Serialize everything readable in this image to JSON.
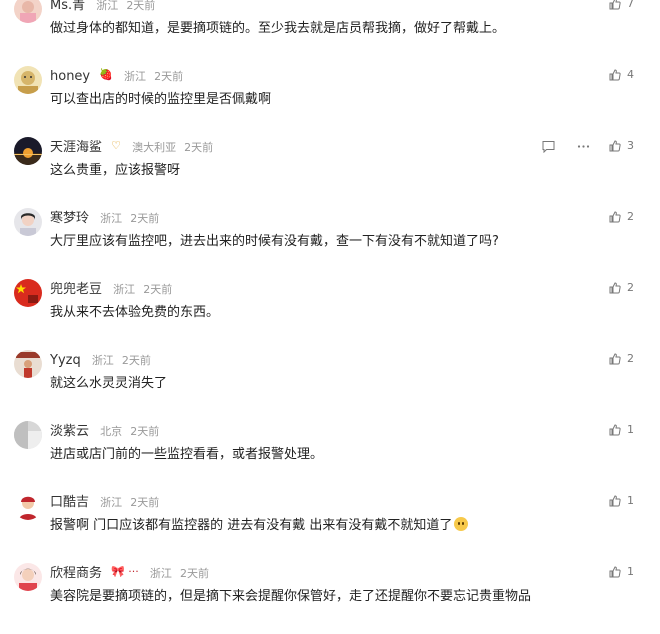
{
  "comments": [
    {
      "user": "Ms.青",
      "badge": "",
      "location": "浙江",
      "time": "2天前",
      "text": "做过身体的都知道，是要摘项链的。至少我去就是店员帮我摘，做好了帮戴上。",
      "likes": "7",
      "emoji": false
    },
    {
      "user": "honey",
      "badge": "🍓",
      "location": "浙江",
      "time": "2天前",
      "text": "可以查出店的时候的监控里是否佩戴啊",
      "likes": "4",
      "emoji": false
    },
    {
      "user": "天涯海鲨",
      "badge": "♡",
      "location": "澳大利亚",
      "time": "2天前",
      "text": "这么贵重，应该报警呀",
      "likes": "3",
      "emoji": false
    },
    {
      "user": "寒梦玲",
      "badge": "",
      "location": "浙江",
      "time": "2天前",
      "text": "大厅里应该有监控吧，进去出来的时候有没有戴，查一下有没有不就知道了吗?",
      "likes": "2",
      "emoji": false
    },
    {
      "user": "兜兜老豆",
      "badge": "",
      "location": "浙江",
      "time": "2天前",
      "text": "我从来不去体验免费的东西。",
      "likes": "2",
      "emoji": false
    },
    {
      "user": "Yyzq",
      "badge": "",
      "location": "浙江",
      "time": "2天前",
      "text": "就这么水灵灵消失了",
      "likes": "2",
      "emoji": false
    },
    {
      "user": "淡紫云",
      "badge": "",
      "location": "北京",
      "time": "2天前",
      "text": "进店或店门前的一些监控看看，或者报警处理。",
      "likes": "1",
      "emoji": false
    },
    {
      "user": "口酷吉",
      "badge": "",
      "location": "浙江",
      "time": "2天前",
      "text": "报警啊 门口应该都有监控器的 进去有没有戴 出来有没有戴不就知道了",
      "likes": "1",
      "emoji": true
    },
    {
      "user": "欣程商务",
      "badge": "🎀 ···",
      "location": "浙江",
      "time": "2天前",
      "text": "美容院是要摘项链的，但是摘下来会提醒你保管好，走了还提醒你不要忘记贵重物品",
      "likes": "1",
      "emoji": false
    }
  ],
  "colors": {
    "meta_gray": "#999999",
    "text": "#222222",
    "username": "#333333"
  },
  "icons": {
    "like": "thumbs-up-icon",
    "reply": "comment-icon",
    "more": "more-icon"
  }
}
